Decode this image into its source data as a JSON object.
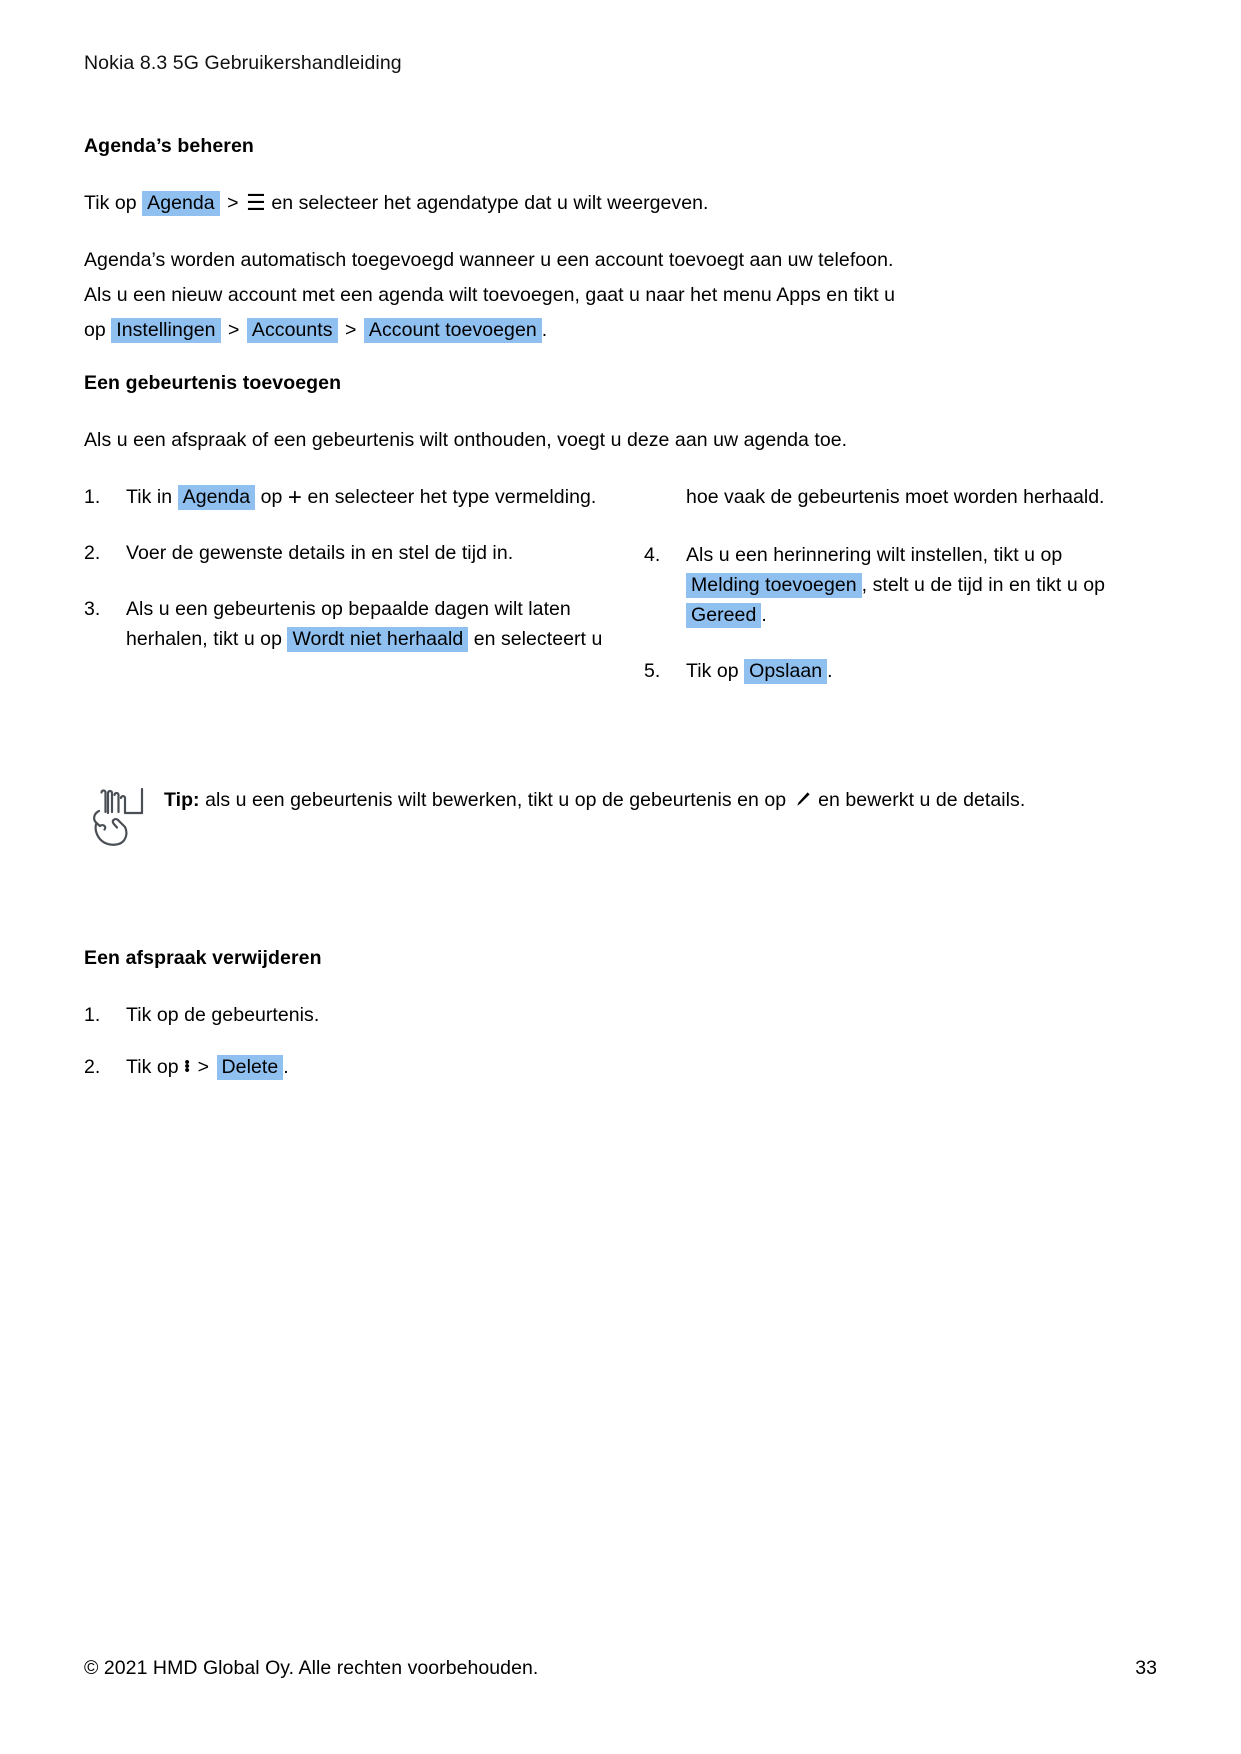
{
  "document": {
    "running_header": "Nokia 8.3 5G Gebruikershandleiding",
    "page_number": "33",
    "copyright": "© 2021 HMD Global Oy. Alle rechten voorbehouden."
  },
  "highlight_color": "#8fc0f0",
  "section1": {
    "title": "Agenda’s beheren",
    "p1": {
      "before": "Tik op",
      "key1": "Agenda",
      "sep": ">",
      "icon": "hamburger-menu-icon",
      "after": "en selecteer het agendatype dat u wilt weergeven."
    },
    "p2": {
      "line1": "Agenda’s worden automatisch toegevoegd wanneer u een account toevoegt aan uw telefoon.",
      "line2": "Als u een nieuw account met een agenda wilt toevoegen, gaat u naar het menu Apps en tikt u",
      "line3_before": "op",
      "key1": "Instellingen",
      "sep1": ">",
      "key2": "Accounts",
      "sep2": ">",
      "key3": "Account toevoegen",
      "line3_after": "."
    }
  },
  "section2": {
    "title": "Een gebeurtenis toevoegen",
    "intro": "Als u een afspraak of een gebeurtenis wilt onthouden, voegt u deze aan uw agenda toe.",
    "steps": [
      {
        "num": "1.",
        "before": "Tik in",
        "key": "Agenda",
        "mid": "op",
        "icon": "plus-icon",
        "after": "en selecteer het type vermelding."
      },
      {
        "num": "2.",
        "text": "Voer de gewenste details in en stel de tijd in."
      },
      {
        "num": "3.",
        "before": "Als u een gebeurtenis op bepaalde dagen wilt laten herhalen, tikt u op",
        "key": "Wordt niet herhaald",
        "after": "en selecteert u"
      },
      {
        "num": "4.",
        "before": "Als u een herinnering wilt instellen, tikt u op",
        "key1": "Melding toevoegen",
        "mid": ", stelt u de tijd in en tikt u op",
        "key2": "Gereed",
        "after": "."
      },
      {
        "num": "5.",
        "before": "Tik op",
        "key": "Opslaan",
        "after": "."
      }
    ],
    "step3_continuation": "hoe vaak de gebeurtenis moet worden herhaald."
  },
  "tip": {
    "icon": "pointing-hand-icon",
    "label": "Tip:",
    "text_before": "als u een gebeurtenis wilt bewerken, tikt u op de gebeurtenis en op",
    "inline_icon": "pencil-edit-icon",
    "text_after": "en bewerkt u de details."
  },
  "section3": {
    "title": "Een afspraak verwijderen",
    "steps": [
      {
        "num": "1.",
        "text": "Tik op de gebeurtenis."
      },
      {
        "num": "2.",
        "before": "Tik op",
        "icon": "more-options-vertical-dots-icon",
        "sep": ">",
        "key": "Delete",
        "after": "."
      }
    ]
  }
}
